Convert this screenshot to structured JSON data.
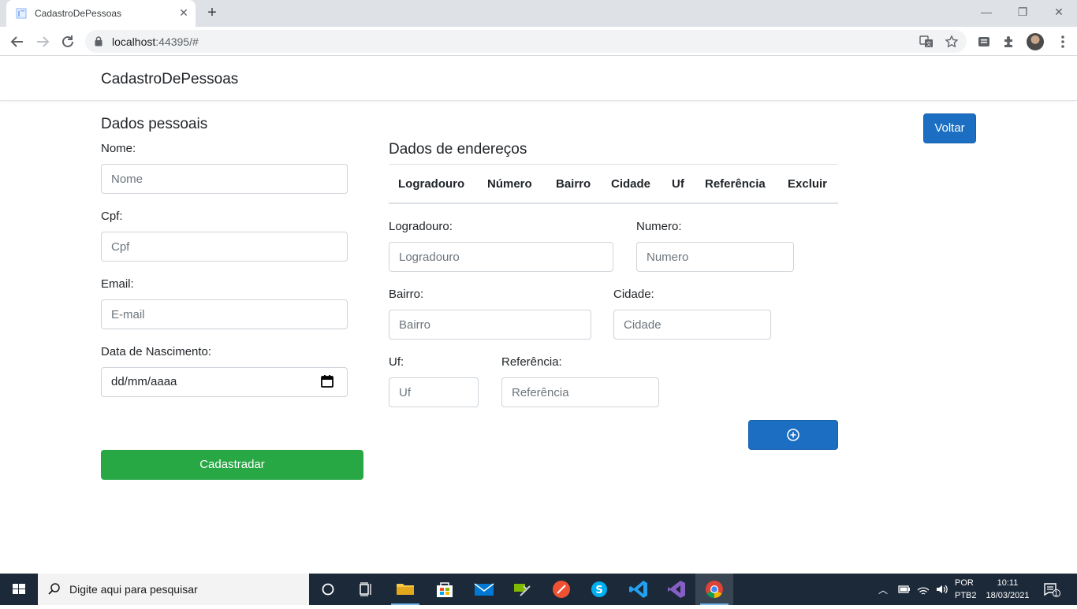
{
  "browser": {
    "tab_title": "CadastroDePessoas",
    "url_host": "localhost",
    "url_rest": ":44395/#"
  },
  "app": {
    "brand": "CadastroDePessoas",
    "back_button": "Voltar"
  },
  "personal": {
    "heading": "Dados pessoais",
    "name_label": "Nome:",
    "name_placeholder": "Nome",
    "cpf_label": "Cpf:",
    "cpf_placeholder": "Cpf",
    "email_label": "Email:",
    "email_placeholder": "E-mail",
    "birth_label": "Data de Nascimento:",
    "birth_value": "dd/mm/aaaa",
    "submit_label": "Cadastradar"
  },
  "address": {
    "heading": "Dados de endereços",
    "columns": [
      "Logradouro",
      "Número",
      "Bairro",
      "Cidade",
      "Uf",
      "Referência",
      "Excluir"
    ],
    "logradouro_label": "Logradouro:",
    "logradouro_placeholder": "Logradouro",
    "numero_label": "Numero:",
    "numero_placeholder": "Numero",
    "bairro_label": "Bairro:",
    "bairro_placeholder": "Bairro",
    "cidade_label": "Cidade:",
    "cidade_placeholder": "Cidade",
    "uf_label": "Uf:",
    "uf_placeholder": "Uf",
    "referencia_label": "Referência:",
    "referencia_placeholder": "Referência"
  },
  "taskbar": {
    "search_placeholder": "Digite aqui para pesquisar",
    "lang_top": "POR",
    "lang_bottom": "PTB2",
    "time": "10:11",
    "date": "18/03/2021",
    "notification_count": "1"
  },
  "colors": {
    "primary": "#1b6ec2",
    "success": "#28a745",
    "taskbar": "#1c2938"
  }
}
